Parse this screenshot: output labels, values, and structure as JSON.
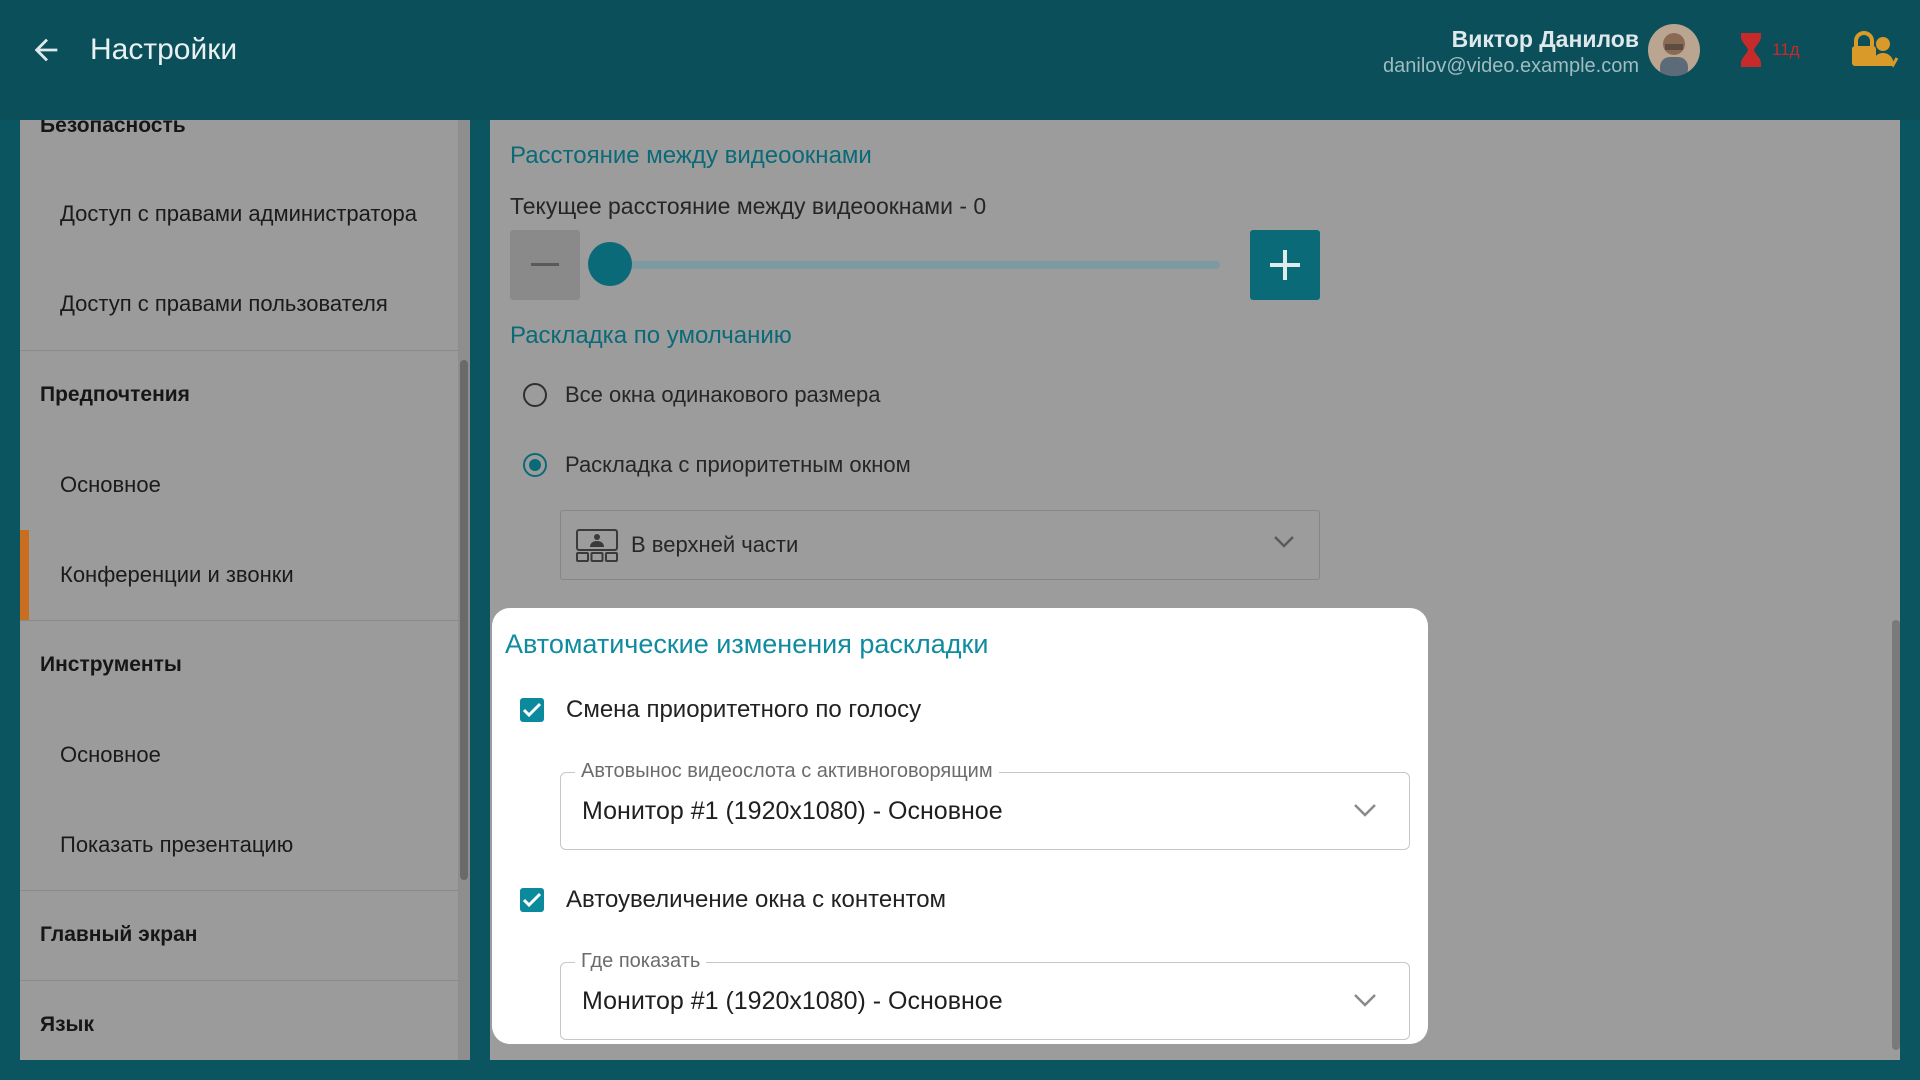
{
  "header": {
    "title": "Настройки",
    "user_name": "Виктор Данилов",
    "user_email": "danilov@video.example.com",
    "timer_text": "11д"
  },
  "sidebar": {
    "sections": [
      {
        "label": "Безопасность",
        "items": [
          "Доступ с правами администратора",
          "Доступ с правами пользователя"
        ]
      },
      {
        "label": "Предпочтения",
        "items": [
          "Основное",
          "Конференции и звонки"
        ]
      },
      {
        "label": "Инструменты",
        "items": [
          "Основное",
          "Показать презентацию"
        ]
      },
      {
        "label": "Главный экран",
        "items": []
      },
      {
        "label": "Язык",
        "items": []
      }
    ],
    "active_item": "Конференции и звонки"
  },
  "main": {
    "spacing_heading": "Расстояние между видеоокнами",
    "spacing_current": "Текущее расстояние между видеоокнами - 0",
    "spacing_value": 0,
    "layout_heading": "Раскладка по умолчанию",
    "layout_options": [
      "Все окна одинакового размера",
      "Раскладка с приоритетным окном"
    ],
    "layout_selected_index": 1,
    "priority_position": "В верхней части"
  },
  "auto_layout": {
    "title": "Автоматические изменения раскладки",
    "voice_switch_label": "Смена приоритетного по голосу",
    "voice_switch_checked": true,
    "speaker_select_legend": "Автовынос видеослота с активноговорящим",
    "speaker_select_value": "Монитор #1 (1920x1080) - Основное",
    "content_zoom_label": "Автоувеличение окна с контентом",
    "content_zoom_checked": true,
    "where_legend": "Где показать",
    "where_value": "Монитор #1 (1920x1080) - Основное"
  },
  "colors": {
    "header_bg": "#0a4f5a",
    "accent": "#0b6a78",
    "card_accent": "#108ba0",
    "active_marker": "#c96d1f",
    "timer": "#c72a2a",
    "lock": "#d99a2a"
  },
  "icons": {
    "back": "arrow-left-icon",
    "timer": "hourglass-icon",
    "lock": "lock-user-icon",
    "layout": "priority-top-layout-icon",
    "chevron": "chevron-down-icon"
  }
}
